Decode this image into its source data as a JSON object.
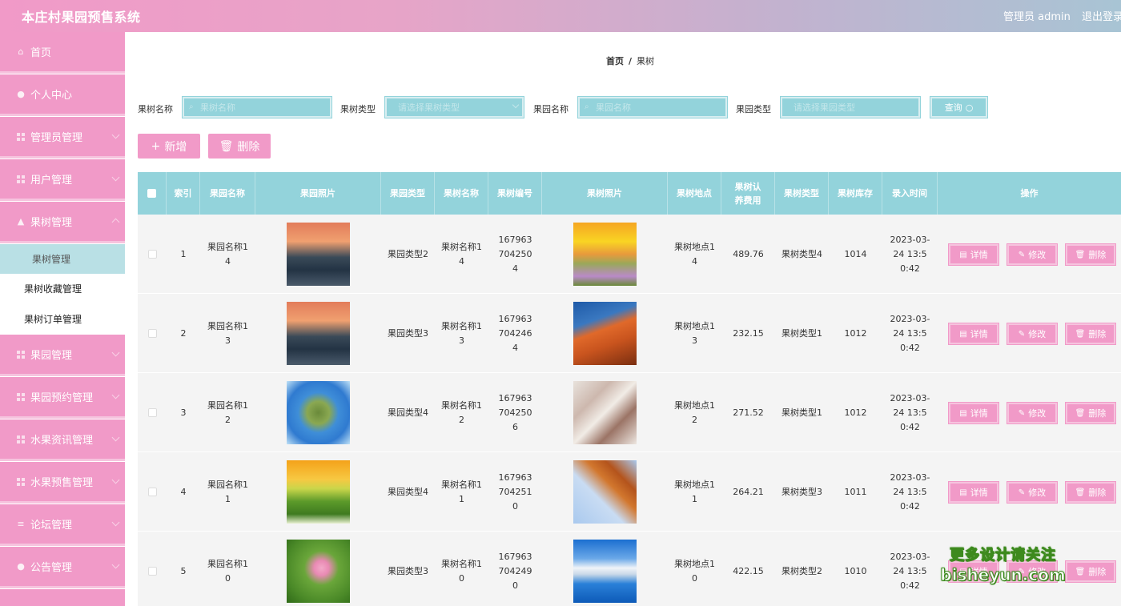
{
  "app": {
    "title": "本庄村果园预售系统",
    "user": "管理员 admin",
    "logout": "退出登录"
  },
  "sidebar": {
    "items": [
      {
        "label": "首页",
        "icon": "home-icon"
      },
      {
        "label": "个人中心",
        "icon": "user-icon"
      },
      {
        "label": "管理员管理",
        "icon": "grid-icon"
      },
      {
        "label": "用户管理",
        "icon": "grid-icon"
      },
      {
        "label": "果树管理",
        "icon": "thumb-icon"
      },
      {
        "label": "果园管理",
        "icon": "grid-icon"
      },
      {
        "label": "果园预约管理",
        "icon": "grid-icon"
      },
      {
        "label": "水果资讯管理",
        "icon": "grid-icon"
      },
      {
        "label": "水果预售管理",
        "icon": "grid-icon"
      },
      {
        "label": "论坛管理",
        "icon": "list-icon"
      },
      {
        "label": "公告管理",
        "icon": "bulb-icon"
      }
    ],
    "subitems": [
      {
        "label": "果树管理"
      },
      {
        "label": "果树收藏管理"
      },
      {
        "label": "果树订单管理"
      }
    ]
  },
  "breadcrumb": {
    "home": "首页",
    "sep": "/",
    "current": "果树"
  },
  "search": {
    "fields": [
      {
        "label": "果树名称",
        "placeholder": "果树名称"
      },
      {
        "label": "果树类型",
        "placeholder": "请选择果树类型"
      },
      {
        "label": "果园名称",
        "placeholder": "果园名称"
      },
      {
        "label": "果园类型",
        "placeholder": "请选择果园类型"
      }
    ],
    "query": "查询"
  },
  "actions": {
    "add": "新增",
    "delete": "删除"
  },
  "table": {
    "headers": [
      "索引",
      "果园名称",
      "果园照片",
      "果园类型",
      "果树名称",
      "果树编号",
      "果树照片",
      "果树地点",
      "果树认养费用",
      "果树类型",
      "果树库存",
      "录入时间",
      "操作"
    ],
    "ops": {
      "detail": "详情",
      "edit": "修改",
      "delete": "删除"
    },
    "rows": [
      {
        "idx": "1",
        "orchard": "果园名称14",
        "orchardType": "果园类型2",
        "tree": "果树名称14",
        "code": "1679637042504",
        "place": "果树地点14",
        "fee": "489.76",
        "treeType": "果树类型4",
        "stock": "1014",
        "time": "2023-03-24 13:50:42"
      },
      {
        "idx": "2",
        "orchard": "果园名称13",
        "orchardType": "果园类型3",
        "tree": "果树名称13",
        "code": "1679637042464",
        "place": "果树地点13",
        "fee": "232.15",
        "treeType": "果树类型1",
        "stock": "1012",
        "time": "2023-03-24 13:50:42"
      },
      {
        "idx": "3",
        "orchard": "果园名称12",
        "orchardType": "果园类型4",
        "tree": "果树名称12",
        "code": "1679637042506",
        "place": "果树地点12",
        "fee": "271.52",
        "treeType": "果树类型1",
        "stock": "1012",
        "time": "2023-03-24 13:50:42"
      },
      {
        "idx": "4",
        "orchard": "果园名称11",
        "orchardType": "果园类型4",
        "tree": "果树名称11",
        "code": "1679637042510",
        "place": "果树地点11",
        "fee": "264.21",
        "treeType": "果树类型3",
        "stock": "1011",
        "time": "2023-03-24 13:50:42"
      },
      {
        "idx": "5",
        "orchard": "果园名称10",
        "orchardType": "果园类型3",
        "tree": "果树名称10",
        "code": "1679637042490",
        "place": "果树地点10",
        "fee": "422.15",
        "treeType": "果树类型2",
        "stock": "1010",
        "time": "2023-03-24 13:50:42"
      }
    ]
  },
  "watermark": {
    "line1": "更多设计请关注",
    "line2": "bisheyun.com"
  },
  "colors": {
    "pink": "#f19ac8",
    "teal": "#93d3db"
  }
}
